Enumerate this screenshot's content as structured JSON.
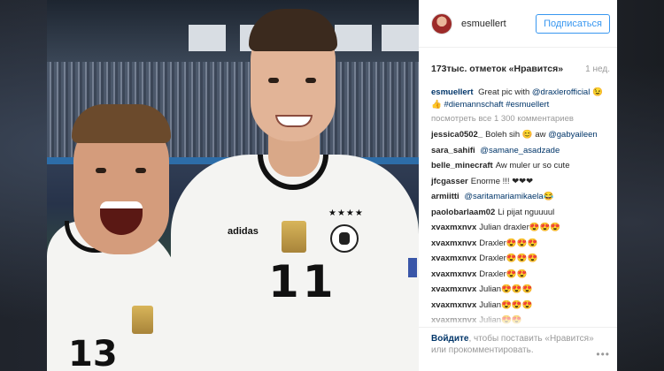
{
  "post": {
    "username": "esmuellert",
    "follow_label": "Подписаться",
    "likes": "173тыс. отметок «Нравится»",
    "time": "1 нед.",
    "caption_user": "esmuellert",
    "caption_text": "Great pic with",
    "caption_mention": "@draxlerofficial",
    "caption_tail": "😉👍",
    "caption_hashtags": "#diemannschaft #esmuellert",
    "view_all": "посмотреть все 1 300 комментариев"
  },
  "comments": [
    {
      "user": "jessica0502_",
      "text": "Boleh sih 😊 aw",
      "mention": "@gabyaileen"
    },
    {
      "user": "sara_sahifi",
      "text": "",
      "mention": "@samane_asadzade"
    },
    {
      "user": "belle_minecraft",
      "text": "Aw muler ur so cute",
      "mention": ""
    },
    {
      "user": "jfcgasser",
      "text": "Enorme !!! ❤❤❤",
      "mention": ""
    },
    {
      "user": "armiitti",
      "text": "",
      "mention": "@saritamariamikaela😂"
    },
    {
      "user": "paolobarlaam02",
      "text": "Li pijat nguuuul",
      "mention": ""
    },
    {
      "user": "xvaxmxnvx",
      "text": "Julian draxler😍😍😍",
      "mention": ""
    },
    {
      "user": "xvaxmxnvx",
      "text": "Draxler😍😍😍",
      "mention": ""
    },
    {
      "user": "xvaxmxnvx",
      "text": "Draxler😍😍😍",
      "mention": ""
    },
    {
      "user": "xvaxmxnvx",
      "text": "Draxler😍😍",
      "mention": ""
    },
    {
      "user": "xvaxmxnvx",
      "text": "Julian😍😍😍",
      "mention": ""
    },
    {
      "user": "xvaxmxnvx",
      "text": "Julian😍😍😍",
      "mention": ""
    },
    {
      "user": "xvaxmxnvx",
      "text": "Julian😍😍",
      "mention": ""
    }
  ],
  "footer": {
    "login": "Войдите",
    "text": ", чтобы поставить «Нравится» или прокомментировать.",
    "more": "•••"
  },
  "photo": {
    "number_right": "11",
    "number_left": "13",
    "brand": "adidas",
    "stars": "★★★★"
  }
}
